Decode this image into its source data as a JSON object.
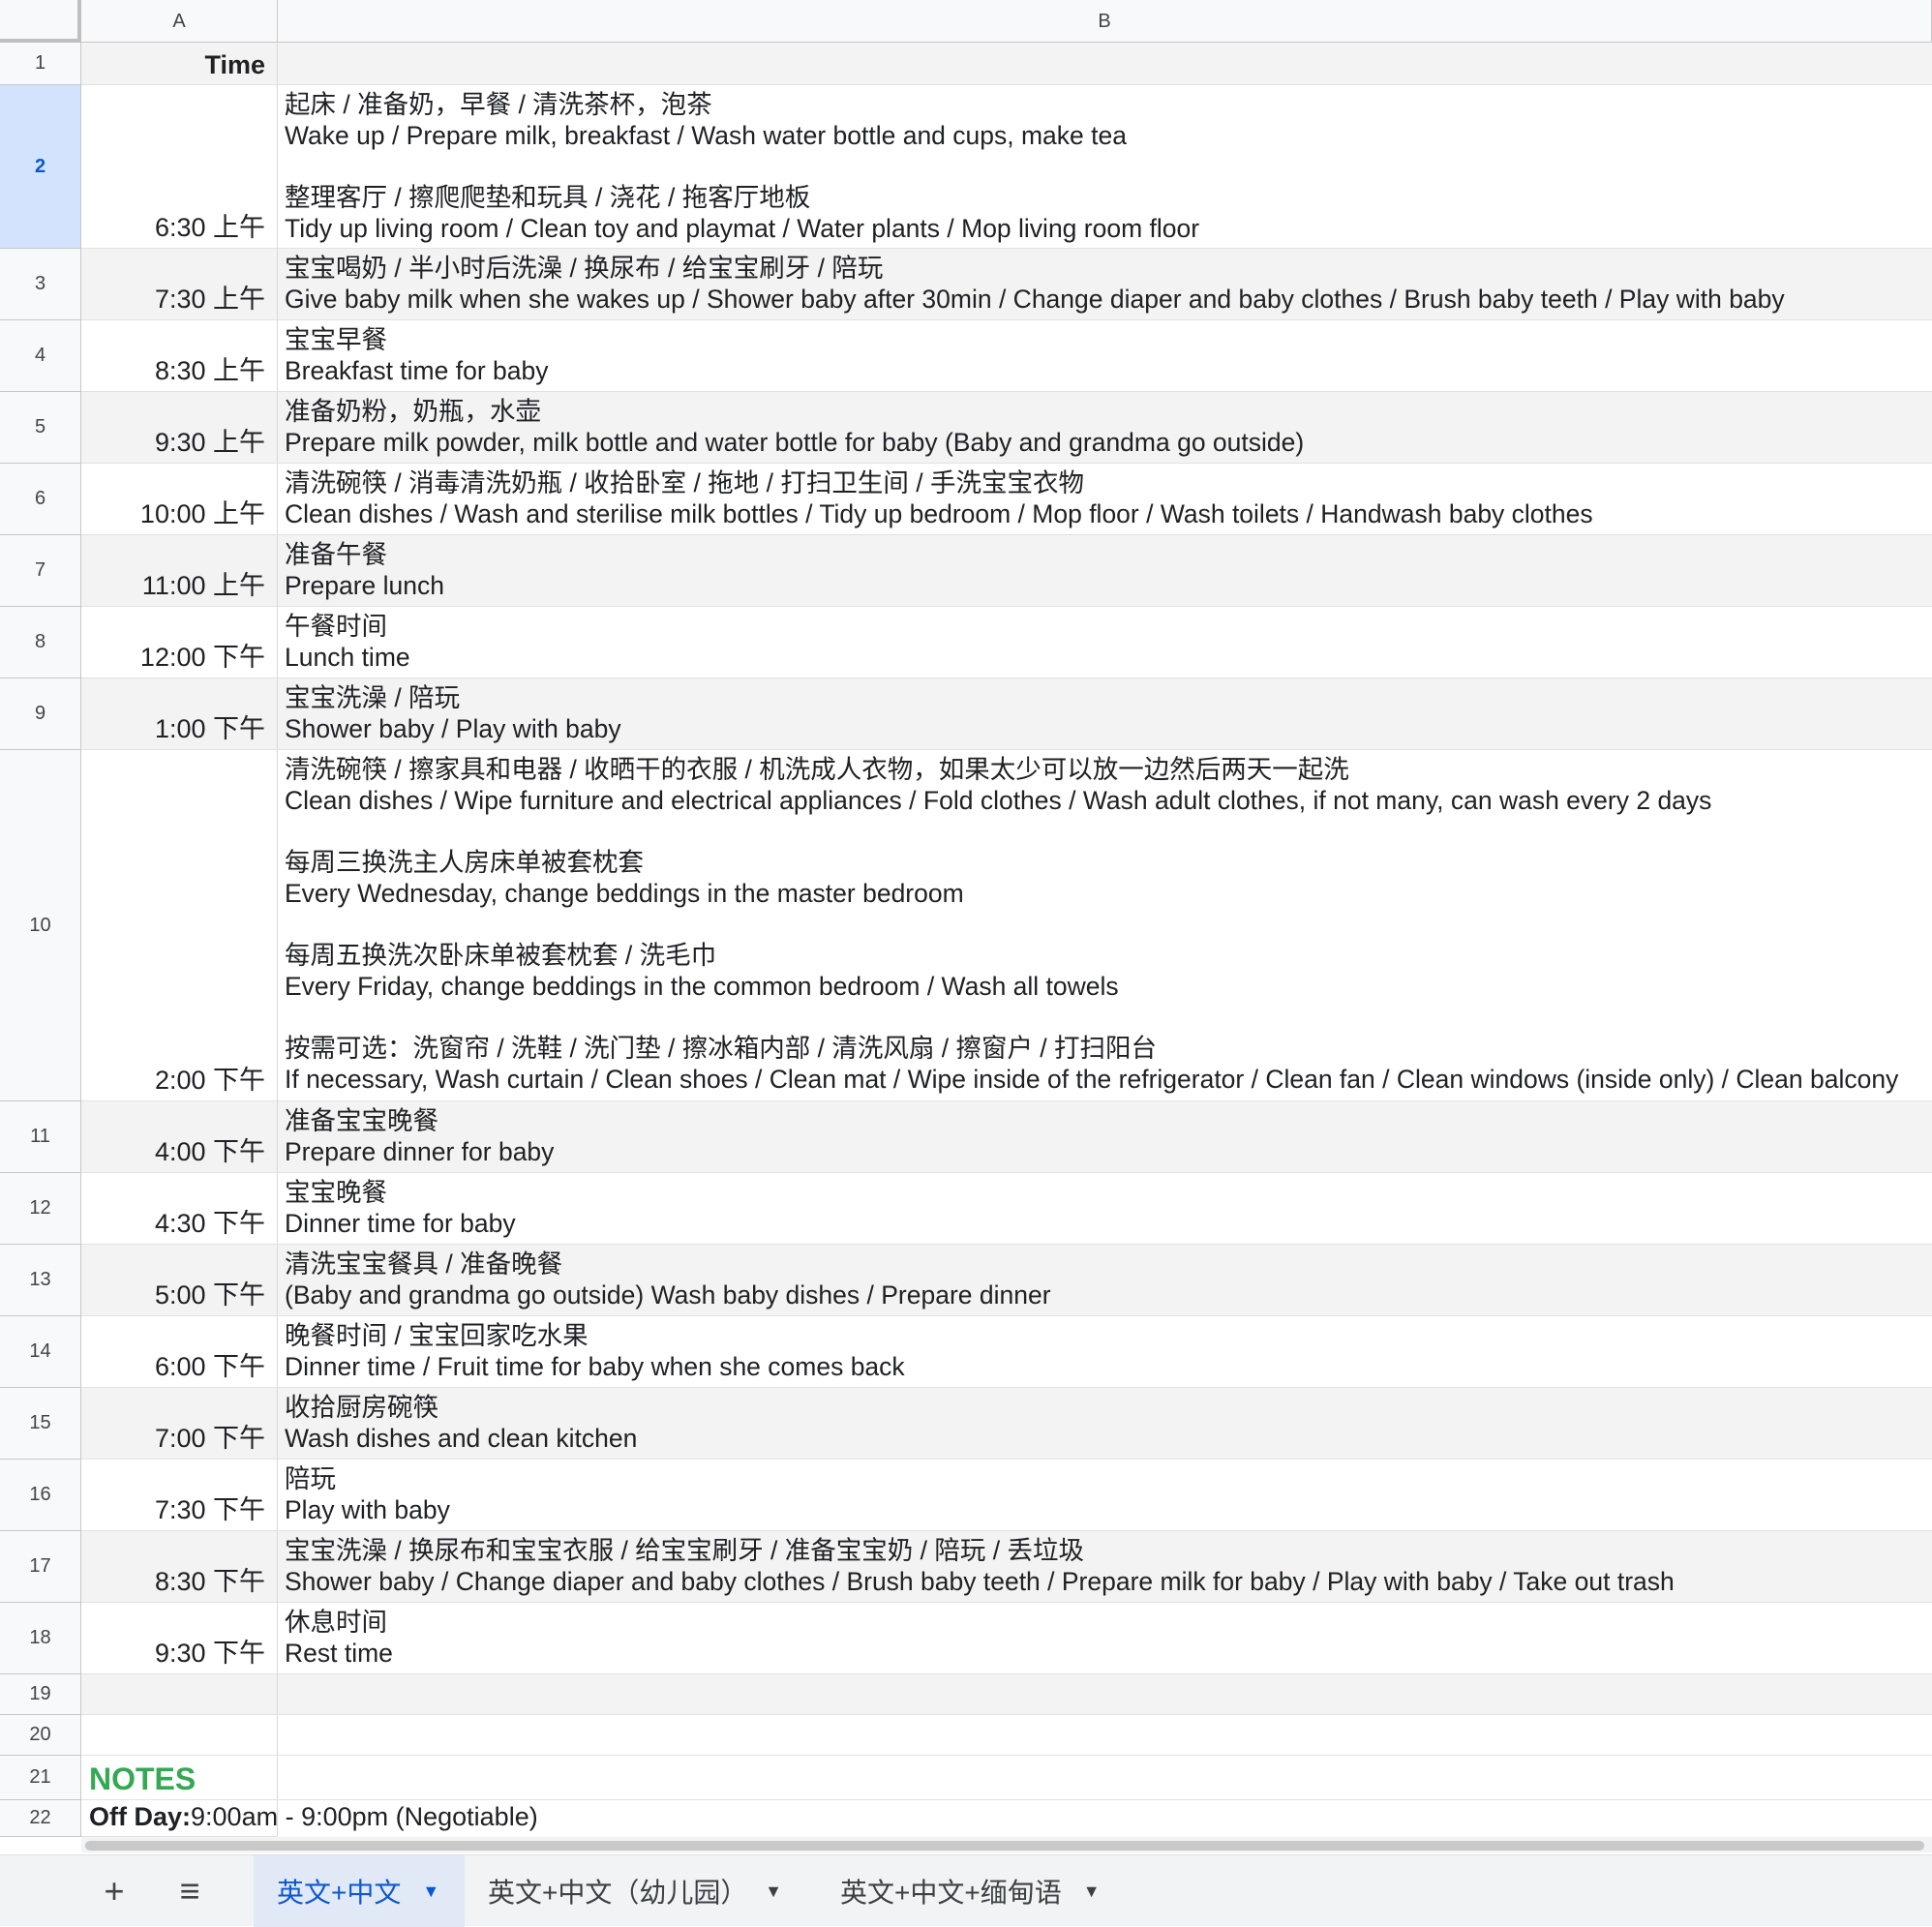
{
  "columns": {
    "a": "A",
    "b": "B"
  },
  "rows": [
    {
      "n": "1",
      "time": "Time",
      "task": ""
    },
    {
      "n": "2",
      "time": "6:30 上午",
      "task": "起床 / 准备奶，早餐 / 清洗茶杯，泡茶\nWake up / Prepare milk, breakfast / Wash water bottle and cups, make tea\n\n整理客厅 / 擦爬爬垫和玩具 / 浇花 / 拖客厅地板\nTidy up living room / Clean toy and playmat / Water plants / Mop living room floor"
    },
    {
      "n": "3",
      "time": "7:30 上午",
      "task": "宝宝喝奶 / 半小时后洗澡 / 换尿布 / 给宝宝刷牙 / 陪玩\nGive baby milk when she wakes up / Shower baby after 30min / Change diaper and baby clothes / Brush baby teeth / Play with baby"
    },
    {
      "n": "4",
      "time": "8:30 上午",
      "task": "宝宝早餐\nBreakfast time for baby"
    },
    {
      "n": "5",
      "time": "9:30 上午",
      "task": "准备奶粉，奶瓶，水壶\nPrepare milk powder, milk bottle and water bottle for baby (Baby and grandma go outside)"
    },
    {
      "n": "6",
      "time": "10:00 上午",
      "task": "清洗碗筷 / 消毒清洗奶瓶 / 收拾卧室 / 拖地 / 打扫卫生间 / 手洗宝宝衣物\nClean dishes / Wash and sterilise milk bottles / Tidy up bedroom / Mop floor / Wash toilets / Handwash baby clothes"
    },
    {
      "n": "7",
      "time": "11:00 上午",
      "task": "准备午餐\nPrepare lunch"
    },
    {
      "n": "8",
      "time": "12:00 下午",
      "task": "午餐时间\nLunch time"
    },
    {
      "n": "9",
      "time": "1:00 下午",
      "task": "宝宝洗澡 / 陪玩\nShower baby / Play with baby"
    },
    {
      "n": "10",
      "time": "2:00 下午",
      "task": "清洗碗筷 / 擦家具和电器 / 收晒干的衣服 / 机洗成人衣物，如果太少可以放一边然后两天一起洗\nClean dishes / Wipe furniture and electrical appliances / Fold clothes / Wash adult clothes, if not many, can wash every 2 days\n\n每周三换洗主人房床单被套枕套\nEvery Wednesday, change beddings in the master bedroom\n\n每周五换洗次卧床单被套枕套 / 洗毛巾\nEvery Friday, change beddings in the common bedroom / Wash all towels\n\n按需可选：洗窗帘 / 洗鞋 / 洗门垫 / 擦冰箱内部 / 清洗风扇 / 擦窗户 / 打扫阳台\nIf necessary, Wash curtain / Clean shoes / Clean mat / Wipe inside of the refrigerator / Clean fan / Clean windows (inside only) / Clean balcony"
    },
    {
      "n": "11",
      "time": "4:00 下午",
      "task": "准备宝宝晚餐\nPrepare dinner for baby"
    },
    {
      "n": "12",
      "time": "4:30 下午",
      "task": "宝宝晚餐\nDinner time for baby"
    },
    {
      "n": "13",
      "time": "5:00 下午",
      "task": "清洗宝宝餐具 / 准备晚餐\n(Baby and grandma go outside) Wash baby dishes / Prepare dinner"
    },
    {
      "n": "14",
      "time": "6:00 下午",
      "task": "晚餐时间 / 宝宝回家吃水果\nDinner time / Fruit time for baby when she comes back"
    },
    {
      "n": "15",
      "time": "7:00 下午",
      "task": "收拾厨房碗筷\nWash dishes and clean kitchen"
    },
    {
      "n": "16",
      "time": "7:30 下午",
      "task": "陪玩\nPlay with baby"
    },
    {
      "n": "17",
      "time": "8:30 下午",
      "task": "宝宝洗澡 / 换尿布和宝宝衣服 / 给宝宝刷牙 / 准备宝宝奶 / 陪玩 / 丢垃圾\nShower baby / Change diaper and baby clothes / Brush baby teeth / Prepare milk for baby / Play with baby / Take out trash"
    },
    {
      "n": "18",
      "time": "9:30 下午",
      "task": "休息时间\nRest time"
    },
    {
      "n": "19",
      "time": "",
      "task": ""
    },
    {
      "n": "20",
      "time": "",
      "task": ""
    }
  ],
  "notes": {
    "n": "21",
    "label": "NOTES"
  },
  "offday": {
    "n": "22",
    "label": "Off Day:",
    "value": " 9:00am - 9:00pm (Negotiable)"
  },
  "tabs": [
    {
      "label": "英文+中文"
    },
    {
      "label": "英文+中文（幼儿园）"
    },
    {
      "label": "英文+中文+缅甸语"
    }
  ],
  "toolbar": {
    "add_icon": "plus-icon",
    "list_icon": "sheet-list-icon"
  }
}
